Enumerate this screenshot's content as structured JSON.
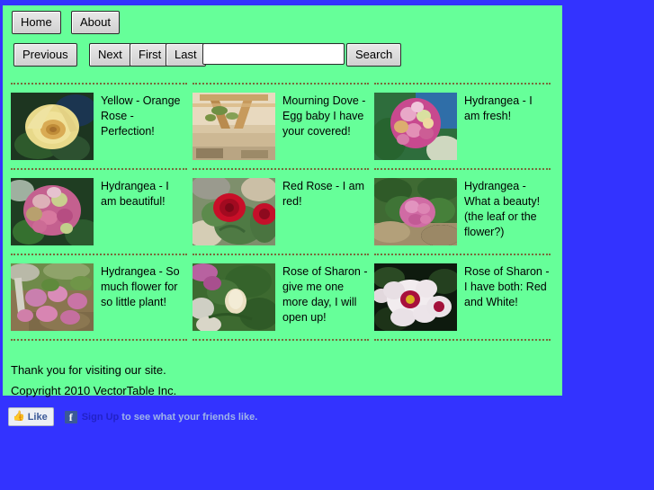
{
  "site": {
    "background_color": "#3333ff",
    "panel_color": "#66ff99"
  },
  "nav": {
    "home_label": "Home",
    "about_label": "About"
  },
  "pager": {
    "previous_label": "Previous",
    "next_label": "Next",
    "first_label": "First",
    "last_label": "Last",
    "search_button_label": "Search",
    "search_value": "",
    "search_placeholder": ""
  },
  "gallery": {
    "rows": [
      {
        "cells": [
          {
            "caption": "Yellow - Orange Rose - Perfection!",
            "image_name": "yellow-orange-rose-photo"
          },
          {
            "caption": "Mourning Dove - Egg baby I have your covered!",
            "image_name": "mourning-dove-pergola-photo"
          },
          {
            "caption": "Hydrangea - I am fresh!",
            "image_name": "hydrangea-fresh-photo"
          }
        ]
      },
      {
        "cells": [
          {
            "caption": "Hydrangea - I am beautiful!",
            "image_name": "hydrangea-beautiful-photo"
          },
          {
            "caption": "Red Rose - I am red!",
            "image_name": "red-rose-photo"
          },
          {
            "caption": "Hydrangea - What a beauty! (the leaf or the flower?)",
            "image_name": "hydrangea-beauty-photo"
          }
        ]
      },
      {
        "cells": [
          {
            "caption": "Hydrangea - So much flower for so little plant!",
            "image_name": "hydrangea-little-plant-photo"
          },
          {
            "caption": "Rose of Sharon - give me one more day, I will open up!",
            "image_name": "rose-of-sharon-bud-photo"
          },
          {
            "caption": "Rose of Sharon - I have both: Red and White!",
            "image_name": "rose-of-sharon-open-photo"
          }
        ]
      }
    ]
  },
  "footer": {
    "thanks": "Thank you for visiting our site.",
    "copyright": "Copyright 2010 VectorTable Inc."
  },
  "facebook": {
    "like_label": "Like",
    "logo_letter": "f",
    "signup_label": "Sign Up",
    "social_text": "to see what your friends like."
  }
}
